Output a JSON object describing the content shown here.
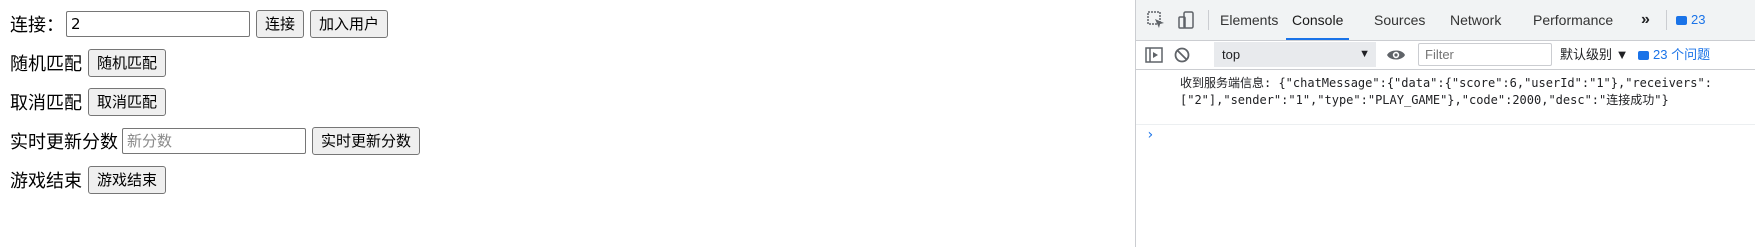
{
  "page": {
    "connect": {
      "label": "连接：",
      "input_value": "2",
      "connect_button": "连接",
      "join_button": "加入用户"
    },
    "random_match": {
      "label": "随机匹配",
      "button": "随机匹配"
    },
    "cancel_match": {
      "label": "取消匹配",
      "button": "取消匹配"
    },
    "update_score": {
      "label": "实时更新分数",
      "placeholder": "新分数",
      "button": "实时更新分数"
    },
    "game_over": {
      "label": "游戏结束",
      "button": "游戏结束"
    }
  },
  "devtools": {
    "tabs": [
      "Elements",
      "Console",
      "Sources",
      "Network",
      "Performance"
    ],
    "active_tab": "Console",
    "more_tabs_icon": "chevrons-right-icon",
    "issues_count": "23",
    "toolbar": {
      "context": "top",
      "filter_placeholder": "Filter",
      "level": "默认级别 ▼",
      "issues_label": "23 个问题"
    },
    "console": {
      "message": "收到服务端信息: {\"chatMessage\":{\"data\":{\"score\":6,\"userId\":\"1\"},\"receivers\":[\"2\"],\"sender\":\"1\",\"type\":\"PLAY_GAME\"},\"code\":2000,\"desc\":\"连接成功\"}",
      "prompt": "›"
    },
    "colors": {
      "accent": "#1a73e8",
      "tab_bar": "#f1f3f4"
    }
  }
}
